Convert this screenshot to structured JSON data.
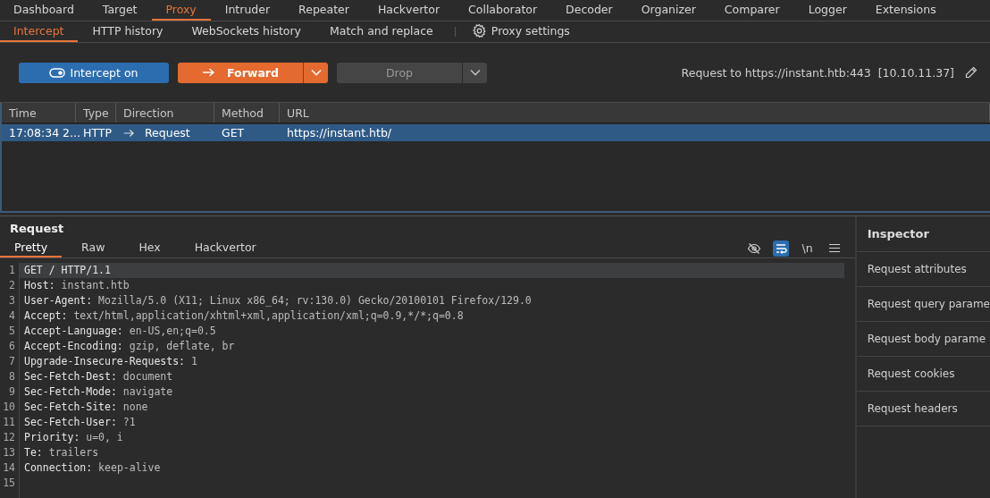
{
  "main_tabs": [
    {
      "label": "Dashboard",
      "selected": false
    },
    {
      "label": "Target",
      "selected": false
    },
    {
      "label": "Proxy",
      "selected": true
    },
    {
      "label": "Intruder",
      "selected": false
    },
    {
      "label": "Repeater",
      "selected": false
    },
    {
      "label": "Hackvertor",
      "selected": false
    },
    {
      "label": "Collaborator",
      "selected": false
    },
    {
      "label": "Decoder",
      "selected": false
    },
    {
      "label": "Organizer",
      "selected": false
    },
    {
      "label": "Comparer",
      "selected": false
    },
    {
      "label": "Logger",
      "selected": false
    },
    {
      "label": "Extensions",
      "selected": false
    }
  ],
  "sub_tabs": [
    {
      "label": "Intercept",
      "selected": true
    },
    {
      "label": "HTTP history",
      "selected": false
    },
    {
      "label": "WebSockets history",
      "selected": false
    },
    {
      "label": "Match and replace",
      "selected": false
    }
  ],
  "proxy_settings": {
    "label": "Proxy settings"
  },
  "toolbar": {
    "intercept": {
      "label": "Intercept on",
      "on": true
    },
    "forward": {
      "label": "Forward",
      "disabled": false
    },
    "drop": {
      "label": "Drop",
      "disabled": true
    },
    "target": "Request to https://instant.htb:443  [10.10.11.37]"
  },
  "table": {
    "columns": [
      "Time",
      "Type",
      "Direction",
      "Method",
      "URL"
    ],
    "rows": [
      {
        "time": "17:08:34 2...",
        "type": "HTTP",
        "direction": "Request",
        "method": "GET",
        "url": "https://instant.htb/",
        "selected": true
      }
    ]
  },
  "request": {
    "title": "Request",
    "tabs": [
      {
        "label": "Pretty",
        "selected": true
      },
      {
        "label": "Raw",
        "selected": false
      },
      {
        "label": "Hex",
        "selected": false
      },
      {
        "label": "Hackvertor",
        "selected": false
      }
    ],
    "tools": [
      {
        "kind": "hide",
        "on": false
      },
      {
        "kind": "wrap",
        "on": true
      },
      {
        "kind": "newline",
        "label": "\\n",
        "on": false
      },
      {
        "kind": "menu",
        "on": false
      }
    ],
    "lines": [
      {
        "number": "1",
        "kind": "request_line",
        "text": "GET / HTTP/1.1",
        "selected": true
      },
      {
        "number": "2",
        "kind": "header",
        "name": "Host:",
        "value": "instant.htb",
        "selected": false
      },
      {
        "number": "3",
        "kind": "header",
        "name": "User-Agent:",
        "value": "Mozilla/5.0 (X11; Linux x86_64; rv:130.0) Gecko/20100101 Firefox/129.0",
        "selected": false
      },
      {
        "number": "4",
        "kind": "header",
        "name": "Accept:",
        "value": "text/html,application/xhtml+xml,application/xml;q=0.9,*/*;q=0.8",
        "selected": false
      },
      {
        "number": "5",
        "kind": "header",
        "name": "Accept-Language:",
        "value": "en-US,en;q=0.5",
        "selected": false
      },
      {
        "number": "6",
        "kind": "header",
        "name": "Accept-Encoding:",
        "value": "gzip, deflate, br",
        "selected": false
      },
      {
        "number": "7",
        "kind": "header",
        "name": "Upgrade-Insecure-Requests:",
        "value": "1",
        "selected": false
      },
      {
        "number": "8",
        "kind": "header",
        "name": "Sec-Fetch-Dest:",
        "value": "document",
        "selected": false
      },
      {
        "number": "9",
        "kind": "header",
        "name": "Sec-Fetch-Mode:",
        "value": "navigate",
        "selected": false
      },
      {
        "number": "10",
        "kind": "header",
        "name": "Sec-Fetch-Site:",
        "value": "none",
        "selected": false
      },
      {
        "number": "11",
        "kind": "header",
        "name": "Sec-Fetch-User:",
        "value": "?1",
        "selected": false
      },
      {
        "number": "12",
        "kind": "header",
        "name": "Priority:",
        "value": "u=0, i",
        "selected": false
      },
      {
        "number": "13",
        "kind": "header",
        "name": "Te:",
        "value": "trailers",
        "selected": false
      },
      {
        "number": "14",
        "kind": "header",
        "name": "Connection:",
        "value": "keep-alive",
        "selected": false
      },
      {
        "number": "15",
        "kind": "blank",
        "selected": false
      }
    ]
  },
  "inspector": {
    "title": "Inspector",
    "items": [
      "Request attributes",
      "Request query parame",
      "Request body parame",
      "Request cookies",
      "Request headers"
    ]
  }
}
